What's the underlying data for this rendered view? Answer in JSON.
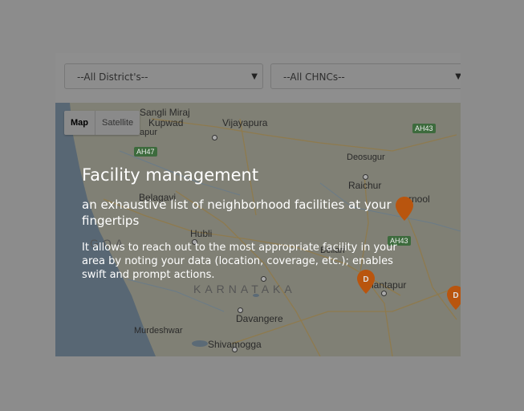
{
  "filters": {
    "district": "--All District's--",
    "chnc": "--All CHNCs--"
  },
  "map": {
    "type_buttons": {
      "map": "Map",
      "satellite": "Satellite"
    },
    "places": {
      "sangli_miraj": "Sangli Miraj",
      "kupwad": "Kupwad",
      "vijayapura": "Vijayapura",
      "apur": "apur",
      "deosugur": "Deosugur",
      "raichur": "Raichur",
      "belagavi": "Belagavi",
      "kurnool": "rnool",
      "goa": "GOA",
      "hubli": "Hubli",
      "bellari": "Bellari",
      "anantapur": "Anantapur",
      "karnataka": "KARNATAKA",
      "davangere": "Davangere",
      "murdeshwar": "Murdeshwar",
      "shivamogga": "Shivamogga"
    },
    "highways": {
      "ah43_top": "AH43",
      "ah47": "AH47",
      "ah43_mid": "AH43"
    },
    "marker_letter": "D",
    "marker_color": "#b9550e"
  },
  "overlay": {
    "title": "Facility management",
    "subtitle": "an exhaustive list of neighborhood facilities at your fingertips",
    "description": "It allows to reach out to the most appropriate facility in your area by noting your data (location, coverage, etc.); enables swift and prompt actions."
  }
}
